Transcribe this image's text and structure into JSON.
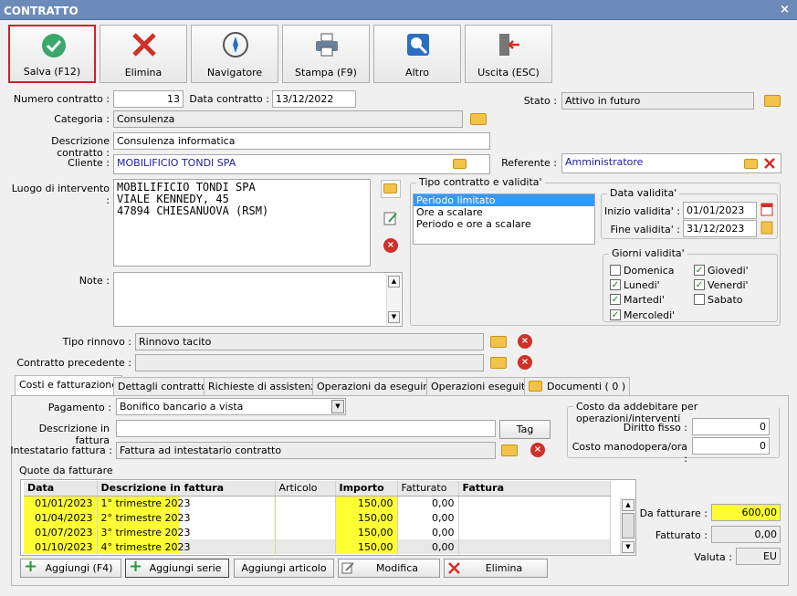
{
  "window": {
    "title": "CONTRATTO",
    "close": "×"
  },
  "toolbar": [
    {
      "label": "Salva (F12)",
      "icon": "check-icon"
    },
    {
      "label": "Elimina",
      "icon": "red-x-icon"
    },
    {
      "label": "Navigatore",
      "icon": "compass-icon"
    },
    {
      "label": "Stampa (F9)",
      "icon": "printer-icon"
    },
    {
      "label": "Altro",
      "icon": "magnifier-icon"
    },
    {
      "label": "Uscita (ESC)",
      "icon": "exit-door-icon"
    }
  ],
  "form": {
    "numero_label": "Numero contratto :",
    "numero": "13",
    "data_label": "Data contratto :",
    "data": "13/12/2022",
    "stato_label": "Stato :",
    "stato": "Attivo in futuro",
    "categoria_label": "Categoria :",
    "categoria": "Consulenza",
    "descrizione_label": "Descrizione contratto :",
    "descrizione": "Consulenza informatica",
    "cliente_label": "Cliente :",
    "cliente": "MOBILIFICIO TONDI SPA",
    "referente_label": "Referente :",
    "referente": "Amministratore",
    "luogo_label": "Luogo di intervento :",
    "luogo_lines": [
      "MOBILIFICIO TONDI SPA",
      "VIALE KENNEDY, 45",
      "47894 CHIESANUOVA (RSM)"
    ],
    "note_label": "Note :",
    "rinnovo_label": "Tipo rinnovo :",
    "rinnovo": "Rinnovo tacito",
    "precedente_label": "Contratto precedente :",
    "precedente": ""
  },
  "tipo": {
    "title": "Tipo contratto e validita'",
    "options": [
      "Periodo limitato",
      "Ore a scalare",
      "Periodo e ore a scalare"
    ],
    "selected": 0
  },
  "validita": {
    "title": "Data validita'",
    "inizio_label": "Inizio validita' :",
    "inizio": "01/01/2023",
    "fine_label": "Fine validita' :",
    "fine": "31/12/2023"
  },
  "giorni": {
    "title": "Giorni validita'",
    "days": [
      {
        "label": "Domenica",
        "checked": false
      },
      {
        "label": "Lunedi'",
        "checked": true
      },
      {
        "label": "Martedi'",
        "checked": true
      },
      {
        "label": "Mercoledi'",
        "checked": true
      },
      {
        "label": "Giovedi'",
        "checked": true
      },
      {
        "label": "Venerdi'",
        "checked": true
      },
      {
        "label": "Sabato",
        "checked": false
      }
    ]
  },
  "tabs": [
    "Costi e fatturazione",
    "Dettagli contratto",
    "Richieste di assistenza",
    "Operazioni da eseguire",
    "Operazioni eseguite",
    "Documenti ( 0 )"
  ],
  "fatt": {
    "pagamento_label": "Pagamento :",
    "pagamento": "Bonifico bancario a vista",
    "descr_label": "Descrizione in fattura",
    "descr": "",
    "tag_label": "Tag",
    "intest_label": "Intestatario fattura :",
    "intest": "Fattura ad intestatario contratto",
    "quote_label": "Quote da fatturare"
  },
  "costi": {
    "title": "Costo da addebitare per operazioni/interventi",
    "fisso_label": "Diritto fisso :",
    "fisso": "0",
    "ora_label": "Costo manodopera/ora :",
    "ora": "0"
  },
  "grid": {
    "columns": [
      "Data",
      "Descrizione in fattura",
      "Articolo",
      "Importo",
      "Fatturato",
      "Fattura"
    ],
    "rows": [
      [
        "01/01/2023",
        "1° trimestre 2023",
        "",
        "150,00",
        "0,00",
        ""
      ],
      [
        "01/04/2023",
        "2° trimestre 2023",
        "",
        "150,00",
        "0,00",
        ""
      ],
      [
        "01/07/2023",
        "3° trimestre 2023",
        "",
        "150,00",
        "0,00",
        ""
      ],
      [
        "01/10/2023",
        "4° trimestre 2023",
        "",
        "150,00",
        "0,00",
        ""
      ]
    ]
  },
  "totals": {
    "da_label": "Da fatturare :",
    "da": "600,00",
    "fatt_label": "Fatturato :",
    "fatt": "0,00",
    "valuta_label": "Valuta :",
    "valuta": "EU"
  },
  "bottom": [
    "Aggiungi (F4)",
    "Aggiungi serie",
    "Aggiungi articolo",
    "Modifica",
    "Elimina"
  ]
}
